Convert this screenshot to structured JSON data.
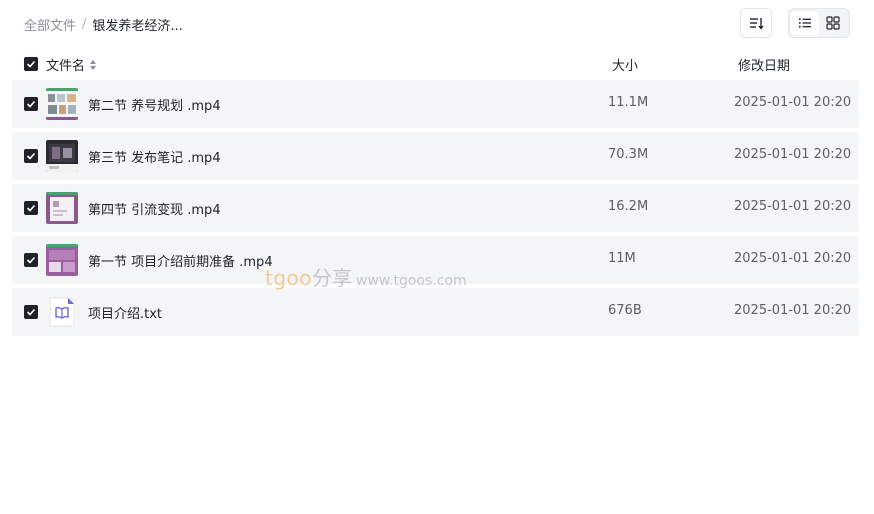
{
  "breadcrumb": {
    "root": "全部文件",
    "separator": "/",
    "current": "银发养老经济..."
  },
  "toolbar": {
    "sort_icon": "sort-icon",
    "list_view_icon": "list-view-icon",
    "grid_view_icon": "grid-view-icon",
    "active_view": "list"
  },
  "table": {
    "headers": {
      "name": "文件名",
      "size": "大小",
      "date": "修改日期"
    },
    "rows": [
      {
        "name": "第二节 养号规划 .mp4",
        "size": "11.1M",
        "date": "2025-01-01 20:20",
        "type": "video",
        "checked": true
      },
      {
        "name": "第三节 发布笔记 .mp4",
        "size": "70.3M",
        "date": "2025-01-01 20:20",
        "type": "video",
        "checked": true
      },
      {
        "name": "第四节 引流变现 .mp4",
        "size": "16.2M",
        "date": "2025-01-01 20:20",
        "type": "video",
        "checked": true
      },
      {
        "name": "第一节 项目介绍前期准备 .mp4",
        "size": "11M",
        "date": "2025-01-01 20:20",
        "type": "video",
        "checked": true
      },
      {
        "name": "项目介绍.txt",
        "size": "676B",
        "date": "2025-01-01 20:20",
        "type": "text",
        "checked": true
      }
    ]
  },
  "watermark": {
    "brand": "tgoo",
    "cn": "分享",
    "url": "www.tgoos.com"
  },
  "colors": {
    "row_bg": "#f4f5f7",
    "checkbox": "#1f2329",
    "muted_text": "#8a8f99",
    "txt_icon": "#6b6bd6"
  }
}
